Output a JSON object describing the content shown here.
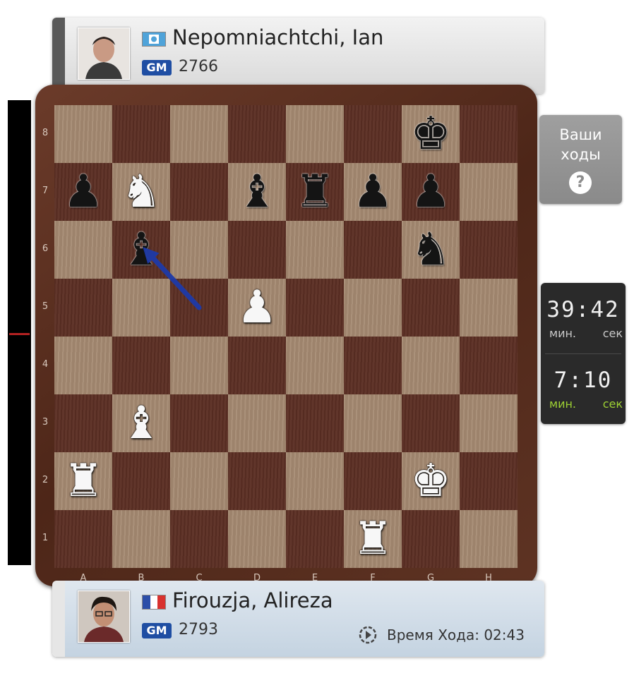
{
  "top_player": {
    "name": "Nepomniachtchi, Ian",
    "title": "GM",
    "rating": "2766",
    "flag": "flag-fide-icon"
  },
  "bottom_player": {
    "name": "Firouzja, Alireza",
    "title": "GM",
    "rating": "2793",
    "flag": "flag-france-icon",
    "move_time_label": "Время Хода: 02:43"
  },
  "hint": {
    "label": "Ваши\nходы",
    "icon": "?"
  },
  "clock": {
    "top_time": "39:42",
    "bottom_time": "7:10",
    "min_label": "мин.",
    "sec_label": "сек"
  },
  "board": {
    "ranks": [
      "8",
      "7",
      "6",
      "5",
      "4",
      "3",
      "2",
      "1"
    ],
    "files": [
      "A",
      "B",
      "C",
      "D",
      "E",
      "F",
      "G",
      "H"
    ],
    "pieces": [
      {
        "square": "g8",
        "type": "king",
        "color": "black"
      },
      {
        "square": "a7",
        "type": "pawn",
        "color": "black"
      },
      {
        "square": "b7",
        "type": "knight",
        "color": "white"
      },
      {
        "square": "d7",
        "type": "bishop",
        "color": "black"
      },
      {
        "square": "e7",
        "type": "rook",
        "color": "black"
      },
      {
        "square": "f7",
        "type": "pawn",
        "color": "black"
      },
      {
        "square": "g7",
        "type": "pawn",
        "color": "black"
      },
      {
        "square": "b6",
        "type": "bishop",
        "color": "black"
      },
      {
        "square": "g6",
        "type": "knight",
        "color": "black"
      },
      {
        "square": "d5",
        "type": "pawn",
        "color": "white"
      },
      {
        "square": "b3",
        "type": "bishop",
        "color": "white"
      },
      {
        "square": "a2",
        "type": "rook",
        "color": "white"
      },
      {
        "square": "g2",
        "type": "king",
        "color": "white"
      },
      {
        "square": "f1",
        "type": "rook",
        "color": "white"
      }
    ],
    "arrow": {
      "from": "c5",
      "to": "b6",
      "color": "#1e3aa8"
    },
    "evaluation_marker": 0.5
  }
}
